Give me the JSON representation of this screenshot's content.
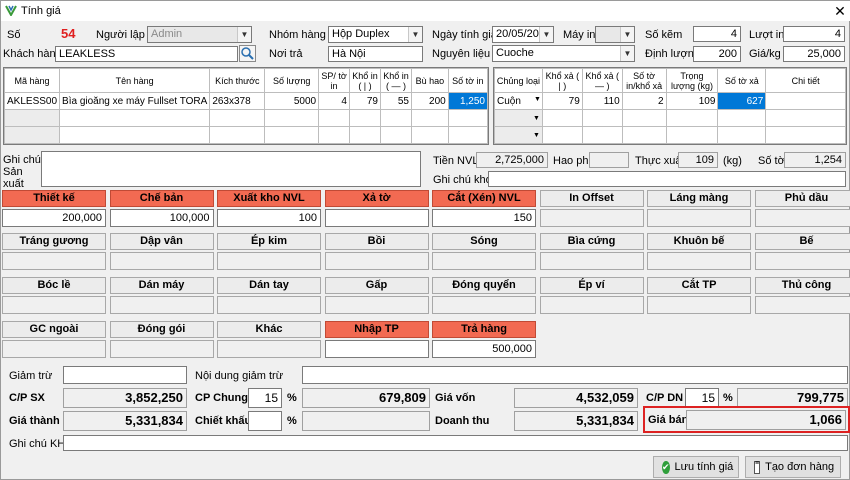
{
  "window": {
    "title": "Tính giá"
  },
  "header": {
    "so_label": "Số",
    "so_value": "54",
    "nguoi_lap_label": "Người lập",
    "nguoi_lap_value": "Admin",
    "nhom_hang_label": "Nhóm hàng",
    "nhom_hang_value": "Hộp Duplex",
    "ngay_label": "Ngày tính giá",
    "ngay_value": "20/05/2021",
    "may_in_label": "Máy in",
    "may_in_value": "",
    "so_kem_label": "Số kẽm",
    "so_kem_value": "4",
    "luot_in_label": "Lượt in",
    "luot_in_value": "4",
    "khach_hang_label": "Khách hàng",
    "khach_hang_value": "LEAKLESS",
    "noi_tra_label": "Nơi trả",
    "noi_tra_value": "Hà Nội",
    "nguyen_lieu_label": "Nguyên liệu",
    "nguyen_lieu_value": "Cuoche",
    "dinh_luong_label": "Định lượng",
    "dinh_luong_value": "200",
    "gia_kg_label": "Giá/kg",
    "gia_kg_value": "25,000"
  },
  "grid1": {
    "headers": [
      "Mã hàng",
      "Tên hàng",
      "Kích thước",
      "Số lượng",
      "SP/ tờ in",
      "Khổ in ( | )",
      "Khổ in ( — )",
      "Bù hao",
      "Số tờ in"
    ],
    "row": {
      "ma": "AKLESS00",
      "ten": "Bìa gioăng xe máy Fullset TORA",
      "kich_thuoc": "263x378",
      "so_luong": "5000",
      "sp_to": "4",
      "kho_in_1": "79",
      "kho_in_2": "55",
      "bu_hao": "200",
      "so_to_in": "1,250"
    }
  },
  "grid2": {
    "headers": [
      "Chủng loại",
      "Khổ xả ( | )",
      "Khổ xả ( — )",
      "Số tờ in/khổ xả",
      "Trọng lượng (kg)",
      "Số tờ xả",
      "Chi tiết"
    ],
    "row": {
      "chung_loai": "Cuộn",
      "kho_xa_1": "79",
      "kho_xa_2": "110",
      "so_to": "2",
      "trong_luong": "109",
      "so_to_xa": "627",
      "chi_tiet": ""
    }
  },
  "mid": {
    "ghi_chu_sx_label": "Ghi chú Sản xuất",
    "tien_nvl_label": "Tiền NVL",
    "tien_nvl_value": "2,725,000",
    "hao_phi_label": "Hao phí",
    "hao_phi_value": "",
    "thuc_xuat_label": "Thực xuất",
    "thuc_xuat_value": "109",
    "kg_label": "(kg)",
    "so_to_label": "Số tờ",
    "so_to_value": "1,254",
    "ghi_chu_kho_label": "Ghi chú kho"
  },
  "sections": [
    {
      "label": "Thiết kế",
      "value": "200,000",
      "red": true
    },
    {
      "label": "Chế bản",
      "value": "100,000",
      "red": true
    },
    {
      "label": "Xuất kho NVL",
      "value": "100",
      "red": true
    },
    {
      "label": "Xả tờ",
      "value": "",
      "red": true
    },
    {
      "label": "Cắt (Xén) NVL",
      "value": "150",
      "red": true
    },
    {
      "label": "In Offset",
      "value": "",
      "red": false
    },
    {
      "label": "Láng màng",
      "value": "",
      "red": false
    },
    {
      "label": "Phủ dầu",
      "value": "",
      "red": false
    },
    {
      "label": "Tráng gương",
      "value": "",
      "red": false
    },
    {
      "label": "Dập vân",
      "value": "",
      "red": false
    },
    {
      "label": "Ép kim",
      "value": "",
      "red": false
    },
    {
      "label": "Bồi",
      "value": "",
      "red": false
    },
    {
      "label": "Sóng",
      "value": "",
      "red": false
    },
    {
      "label": "Bìa cứng",
      "value": "",
      "red": false
    },
    {
      "label": "Khuôn bế",
      "value": "",
      "red": false
    },
    {
      "label": "Bế",
      "value": "",
      "red": false
    },
    {
      "label": "Bóc lề",
      "value": "",
      "red": false
    },
    {
      "label": "Dán máy",
      "value": "",
      "red": false
    },
    {
      "label": "Dán tay",
      "value": "",
      "red": false
    },
    {
      "label": "Gấp",
      "value": "",
      "red": false
    },
    {
      "label": "Đóng quyển",
      "value": "",
      "red": false
    },
    {
      "label": "Ép ví",
      "value": "",
      "red": false
    },
    {
      "label": "Cắt TP",
      "value": "",
      "red": false
    },
    {
      "label": "Thủ công",
      "value": "",
      "red": false
    },
    {
      "label": "GC ngoài",
      "value": "",
      "red": false
    },
    {
      "label": "Đóng gói",
      "value": "",
      "red": false
    },
    {
      "label": "Khác",
      "value": "",
      "red": false
    },
    {
      "label": "Nhập TP",
      "value": "",
      "red": true
    },
    {
      "label": "Trả hàng",
      "value": "500,000",
      "red": true
    }
  ],
  "bottom": {
    "giam_tru_label": "Giảm trừ",
    "giam_tru_value": "",
    "nd_giam_tru_label": "Nội dung giảm trừ",
    "nd_giam_tru_value": "",
    "cp_sx_label": "C/P SX",
    "cp_sx_value": "3,852,250",
    "cp_chung_label": "CP Chung",
    "cp_chung_pct": "15",
    "pct": "%",
    "cp_chung_value": "679,809",
    "gia_von_label": "Giá vốn",
    "gia_von_value": "4,532,059",
    "cp_dn_label": "C/P DN",
    "cp_dn_pct": "15",
    "cp_dn_value": "799,775",
    "gia_thanh_label": "Giá thành",
    "gia_thanh_value": "5,331,834",
    "chiet_khau_label": "Chiết khấu",
    "chiet_khau_pct": "",
    "chiet_khau_value": "",
    "doanh_thu_label": "Doanh thu",
    "doanh_thu_value": "5,331,834",
    "gia_ban_label": "Giá bán",
    "gia_ban_value": "1,066",
    "ghi_chu_kh_label": "Ghi chú KH"
  },
  "buttons": {
    "save": "Lưu tính giá",
    "create_order": "Tạo đơn hàng"
  },
  "colors": {
    "red_header": "#f26a52",
    "selection": "#0078d7",
    "highlight": "#dd2222"
  }
}
